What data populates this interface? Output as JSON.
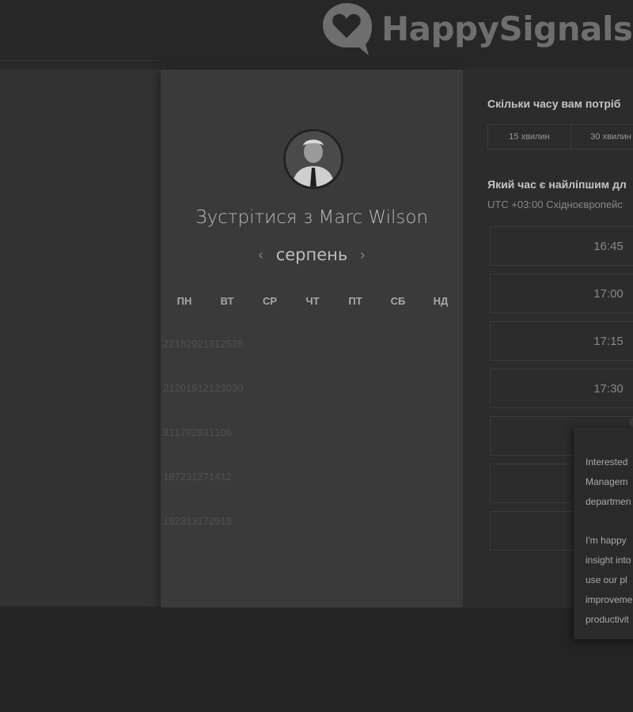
{
  "brand": {
    "name": "HappySignals"
  },
  "host_card": {
    "meet_label": "Зустрітися з Marc Wilson",
    "month": "серпень",
    "prev_arrow": "‹",
    "next_arrow": "›",
    "weekdays": [
      "ПН",
      "ВТ",
      "СР",
      "ЧТ",
      "ПТ",
      "СБ",
      "НД"
    ],
    "weeks": [
      [
        "22",
        "18",
        "29",
        "21",
        "31",
        "25",
        "26"
      ],
      [
        "21",
        "20",
        "19",
        "12",
        "12",
        "30",
        "30"
      ],
      [
        "31",
        "17",
        "9",
        "28",
        "31",
        "10",
        "6"
      ],
      [
        "18",
        "7",
        "2",
        "31",
        "27",
        "14",
        "12"
      ],
      [
        "16",
        "23",
        "1",
        "3",
        "17",
        "29",
        "13"
      ]
    ]
  },
  "scheduler": {
    "duration_question": "Скільки часу вам потріб",
    "durations": [
      "15 хвилин",
      "30 хвилин"
    ],
    "time_question": "Який час є найліпшим дл",
    "timezone": "UTC +03:00 Східноєвропейс",
    "slots": [
      "16:45",
      "17:00",
      "17:15",
      "17:30",
      "",
      "",
      ""
    ]
  },
  "popup": {
    "para1": [
      "Interested",
      "Managem",
      "departmen"
    ],
    "para2": [
      "I'm happy",
      "insight into",
      "use our pl",
      "improveme",
      "productivit"
    ]
  },
  "colors": {
    "background": "#2a2a2a",
    "card": "#3a3a3a",
    "panel": "#2c2c2c"
  }
}
